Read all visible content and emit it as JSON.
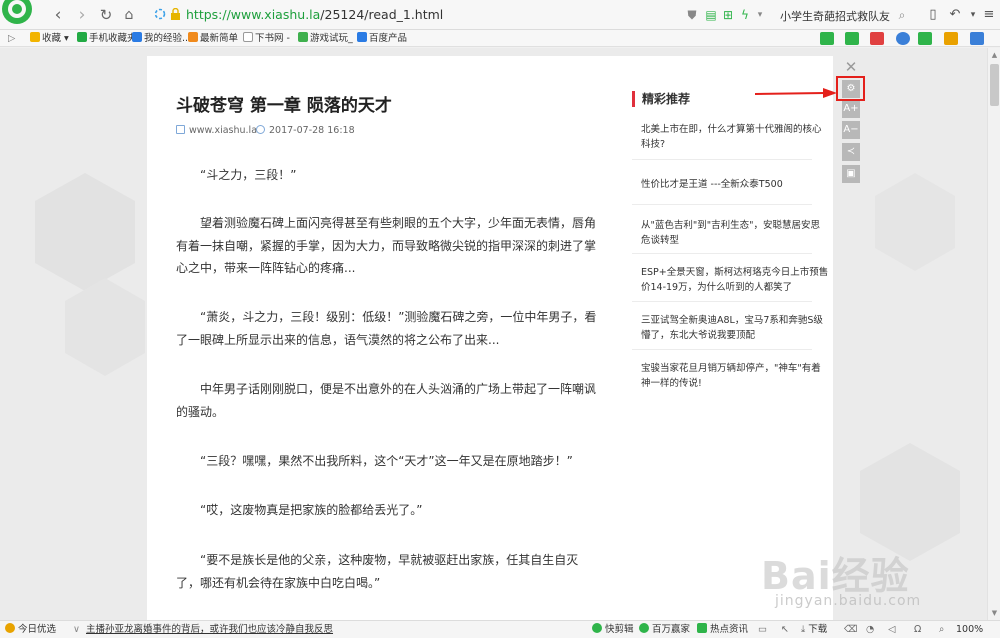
{
  "browser": {
    "url_host": "https://www.xiashu.la",
    "url_path": "/25124/read_1.html",
    "search_value": "小学生奇葩招式救队友",
    "zoom": "100%"
  },
  "bookmarks": [
    {
      "label": "收藏",
      "color": "#f2b400"
    },
    {
      "label": "手机收藏夹",
      "color": "#22aa44"
    },
    {
      "label": "我的经验..",
      "color": "#2a7be4"
    },
    {
      "label": "最新简单",
      "color": "#f08a1c"
    },
    {
      "label": "下书网 -",
      "color": "#bbbbbb"
    },
    {
      "label": "游戏试玩_",
      "color": "#3fb04e"
    },
    {
      "label": "百度产品",
      "color": "#2a7be4"
    }
  ],
  "article": {
    "title": "斗破苍穹 第一章 陨落的天才",
    "site": "www.xiashu.la",
    "time": "2017-07-28 16:18",
    "paragraphs": [
      "“斗之力，三段！”",
      "望着测验魔石碑上面闪亮得甚至有些刺眼的五个大字，少年面无表情，唇角有着一抹自嘲，紧握的手掌，因为大力，而导致略微尖锐的指甲深深的刺进了掌心之中，带来一阵阵钻心的疼痛...",
      "“萧炎，斗之力，三段！级别：低级！”测验魔石碑之旁，一位中年男子，看了一眼碑上所显示出来的信息，语气漠然的将之公布了出来...",
      "中年男子话刚刚脱口，便是不出意外的在人头汹涌的广场上带起了一阵嘲讽的骚动。",
      "“三段？嘿嘿，果然不出我所料，这个“天才”这一年又是在原地踏步！”",
      "“哎，这废物真是把家族的脸都给丢光了。”",
      "“要不是族长是他的父亲，这种废物，早就被驱赶出家族，任其自生自灭了，哪还有机会待在家族中白吃白喝。”"
    ]
  },
  "aside": {
    "heading": "精彩推荐",
    "items": [
      "北美上市在即，什么才算第十代雅阁的核心科技?",
      "性价比才是王道 ---全新众泰T500",
      "从\"蓝色吉利\"到\"吉利生态\"，安聪慧居安思危谈转型",
      "ESP+全景天窗，斯柯达柯珞克今日上市预售价14-19万，为什么听到的人都笑了",
      "三亚试驾全新奥迪A8L，宝马7系和奔驰S级懵了，东北大爷说我要顶配",
      "宝骏当家花旦月销万辆却停产，\"神车\"有着神一样的传说!"
    ]
  },
  "side_tools": {
    "close": "✕",
    "settings": "⚙",
    "font_up": "A+",
    "font_down": "A−",
    "share": "≺",
    "save": "▣"
  },
  "statusbar": {
    "today": "今日优选",
    "news": "主播孙亚龙离婚事件的背后，或许我们也应该冷静自我反思",
    "quick_cut": "快剪辑",
    "million": "百万赢家",
    "hot": "热点资讯",
    "download": "下载",
    "zoom": "100%"
  },
  "watermark": {
    "brand": "Bai经验",
    "domain": "jingyan.baidu.com"
  }
}
